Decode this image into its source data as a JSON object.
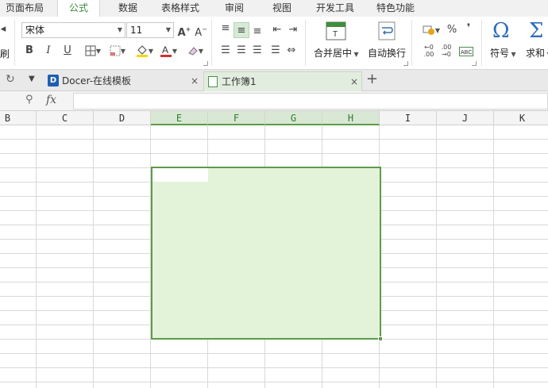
{
  "menu": {
    "tabs": [
      {
        "label": "页面布局"
      },
      {
        "label": "公式",
        "active": true
      },
      {
        "label": "数据"
      },
      {
        "label": "表格样式"
      },
      {
        "label": "审阅"
      },
      {
        "label": "视图"
      },
      {
        "label": "开发工具"
      },
      {
        "label": "特色功能"
      }
    ]
  },
  "ribbon": {
    "clipboard_label_fragment": "刷",
    "font_name": "宋体",
    "font_size": "11",
    "merge_center_label": "合并居中",
    "wrap_text_label": "自动换行",
    "percent_symbol": "%",
    "comma_symbol": "❜",
    "symbol_label": "符号",
    "sum_label": "求和",
    "font_color": "#d32f2f",
    "highlight_color": "#f5d700"
  },
  "tabs": {
    "doc_tabs": [
      {
        "label": "Docer-在线模板",
        "active": false
      },
      {
        "label": "工作簿1",
        "active": true
      }
    ],
    "close_glyph": "×",
    "new_tab_glyph": "+"
  },
  "formula_bar": {
    "fx_label": "fx",
    "value": ""
  },
  "sheet": {
    "columns": [
      "B",
      "C",
      "D",
      "E",
      "F",
      "G",
      "H",
      "I",
      "J",
      "K"
    ],
    "selected_columns": [
      "E",
      "F",
      "G",
      "H"
    ],
    "selected_range": "E4:H15",
    "active_cell": "E4",
    "selection_color": "#e3f3d9",
    "accent_color": "#5c9b4a"
  }
}
